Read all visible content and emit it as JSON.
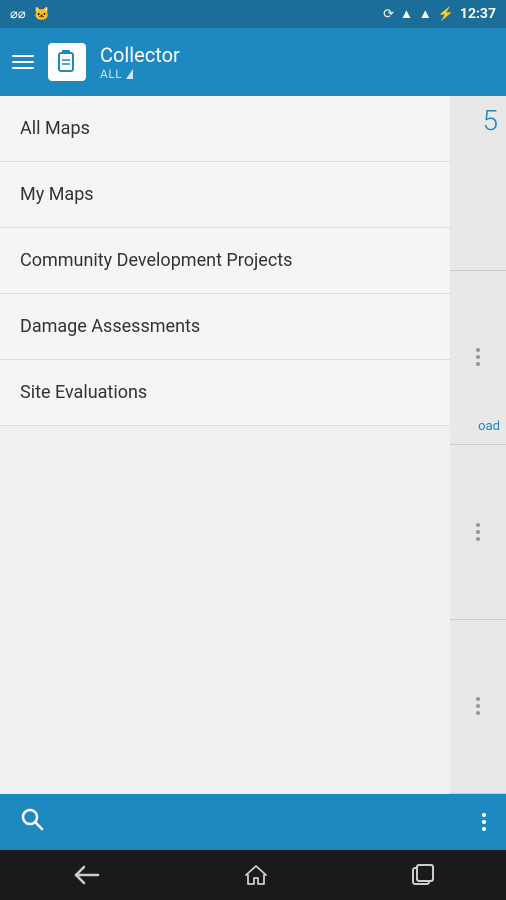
{
  "statusBar": {
    "time": "12:37",
    "leftIcons": [
      "voicemail",
      "cat"
    ]
  },
  "header": {
    "title": "Collector",
    "subtitle": "ALL",
    "hamburgerLabel": "menu"
  },
  "drawer": {
    "items": [
      {
        "id": "all-maps",
        "label": "All Maps"
      },
      {
        "id": "my-maps",
        "label": "My Maps"
      },
      {
        "id": "community-dev",
        "label": "Community Development Projects"
      },
      {
        "id": "damage-assessments",
        "label": "Damage Assessments"
      },
      {
        "id": "site-evaluations",
        "label": "Site Evaluations"
      }
    ]
  },
  "peek": {
    "count": "5",
    "downloadLabel": "oad"
  },
  "toolbar": {
    "searchLabel": "search",
    "moreLabel": "more options"
  },
  "navBar": {
    "backLabel": "back",
    "homeLabel": "home",
    "recentsLabel": "recents"
  }
}
